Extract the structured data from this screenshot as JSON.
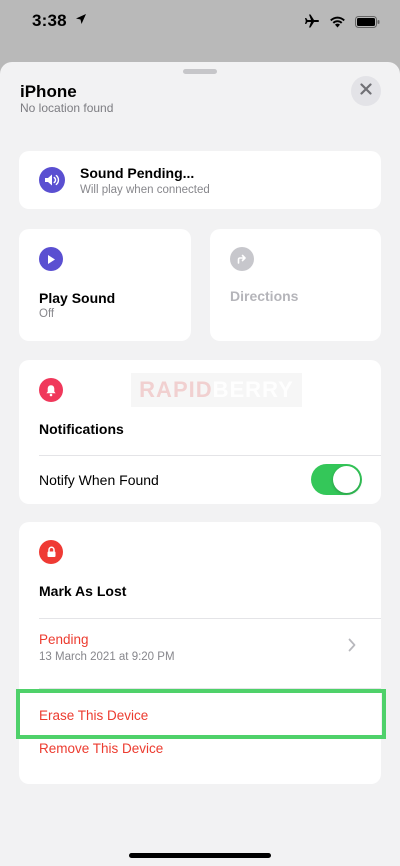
{
  "status_bar": {
    "time": "3:38"
  },
  "sheet": {
    "title": "iPhone",
    "subtitle": "No location found"
  },
  "sound_card": {
    "title": "Sound Pending...",
    "subtitle": "Will play when connected"
  },
  "play_sound": {
    "title": "Play Sound",
    "state": "Off"
  },
  "directions": {
    "title": "Directions"
  },
  "notifications": {
    "title": "Notifications",
    "notify_label": "Notify When Found",
    "notify_on": true
  },
  "mark_as_lost": {
    "title": "Mark As Lost",
    "status": "Pending",
    "date": "13 March 2021 at 9:20 PM"
  },
  "actions": {
    "erase": "Erase This Device",
    "remove": "Remove This Device"
  },
  "watermark": {
    "part1": "RAPID",
    "part2": "BERRY"
  },
  "colors": {
    "accent_purple": "#5a4fd1",
    "destructive_red": "#ec3b2f",
    "toggle_green": "#34c759",
    "highlight_green": "#4fd16a"
  }
}
